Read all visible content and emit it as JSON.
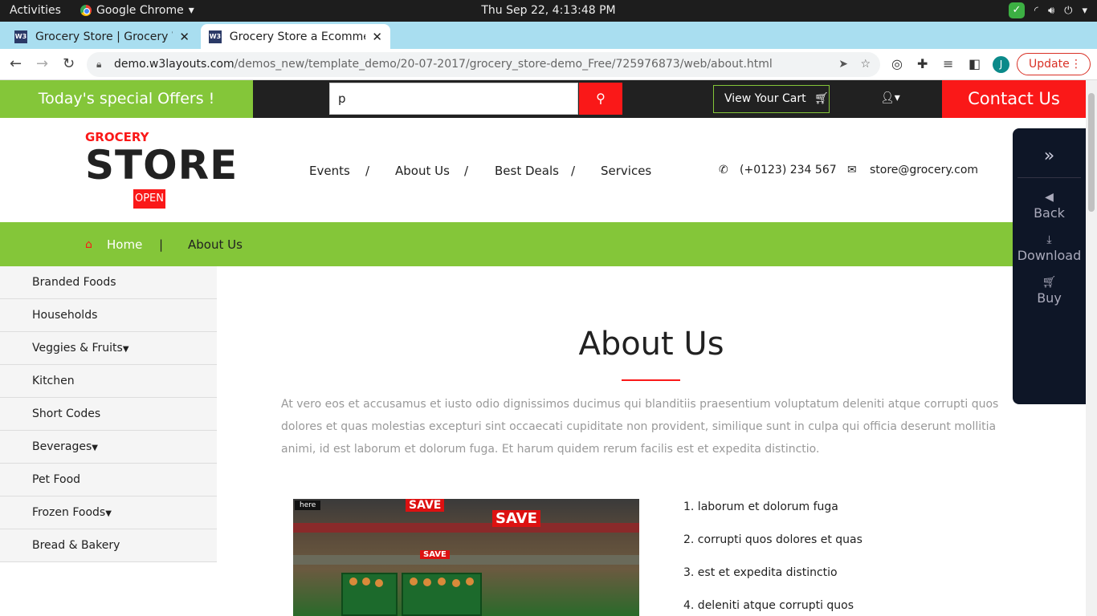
{
  "system": {
    "activities": "Activities",
    "app": "Google Chrome",
    "clock": "Thu Sep 22,  4:13:48 PM"
  },
  "browser": {
    "tabs": [
      {
        "label": "Grocery Store | Grocery W",
        "favicon": "W3"
      },
      {
        "label": "Grocery Store a Ecommerc",
        "favicon": "W3"
      }
    ],
    "url_domain": "demo.w3layouts.com",
    "url_path": "/demos_new/template_demo/20-07-2017/grocery_store-demo_Free/725976873/web/about.html",
    "profile_initial": "J",
    "update_label": "Update"
  },
  "topbar": {
    "offers": "Today's special Offers !",
    "search_value": "p",
    "cart_label": "View Your Cart",
    "contact": "Contact Us"
  },
  "logo": {
    "small": "GROCERY",
    "big": "STORE",
    "sign": "OPEN"
  },
  "menu": [
    "Events",
    "About Us",
    "Best Deals",
    "Services"
  ],
  "menu_separator": "/",
  "contact_info": {
    "phone": "(+0123) 234 567",
    "email": "store@grocery.com"
  },
  "breadcrumb": {
    "home": "Home",
    "separator": "|",
    "current": "About Us"
  },
  "sidebar": [
    {
      "label": "Branded Foods",
      "dropdown": false
    },
    {
      "label": "Households",
      "dropdown": false
    },
    {
      "label": "Veggies & Fruits",
      "dropdown": true
    },
    {
      "label": "Kitchen",
      "dropdown": false
    },
    {
      "label": "Short Codes",
      "dropdown": false
    },
    {
      "label": "Beverages",
      "dropdown": true
    },
    {
      "label": "Pet Food",
      "dropdown": false
    },
    {
      "label": "Frozen Foods",
      "dropdown": true
    },
    {
      "label": "Bread & Bakery",
      "dropdown": false
    }
  ],
  "about": {
    "title": "About Us",
    "paragraph": "At vero eos et accusamus et iusto odio dignissimos ducimus qui blanditiis praesentium voluptatum deleniti atque corrupti quos dolores et quas molestias excepturi sint occaecati cupiditate non provident, similique sunt in culpa qui officia deserunt mollitia animi, id est laborum et dolorum fuga. Et harum quidem rerum facilis est et expedita distinctio.",
    "photo_tag": "here",
    "photo_signs": [
      "SAVE",
      "SAVE",
      "SAVE"
    ],
    "list": [
      "1. laborum et dolorum fuga",
      "2. corrupti quos dolores et quas",
      "3. est et expedita distinctio",
      "4. deleniti atque corrupti quos"
    ]
  },
  "float_panel": {
    "back": "Back",
    "download": "Download",
    "buy": "Buy"
  },
  "colors": {
    "green": "#84c639",
    "red": "#fa1818",
    "dark": "#212121"
  }
}
